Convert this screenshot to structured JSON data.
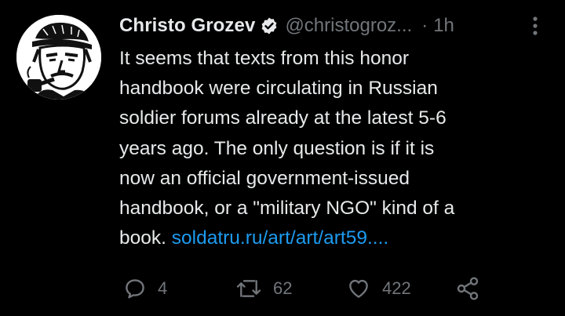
{
  "tweet": {
    "display_name": "Christo Grozev",
    "handle": "@christogroz...",
    "separator": "·",
    "time": "1h",
    "text_lines": [
      "It seems that texts from this honor",
      "handbook were circulating in Russian",
      "soldier forums already at the latest 5-6",
      "years ago. The only question is if it is",
      "now an official government-issued",
      "handbook, or a \"military NGO\" kind of a"
    ],
    "last_line_text": "book.",
    "link_text": "soldatru.ru/art/art/art59....",
    "icons": {
      "verified": "verified-badge-icon",
      "more": "more-vertical-icon",
      "reply": "reply-icon",
      "retweet": "retweet-icon",
      "like": "heart-icon",
      "share": "share-icon"
    }
  },
  "actions": {
    "reply_count": "4",
    "retweet_count": "62",
    "like_count": "422"
  },
  "colors": {
    "background": "#000000",
    "text": "#e7e9ea",
    "secondary": "#71767b",
    "link": "#1d9bf0"
  }
}
